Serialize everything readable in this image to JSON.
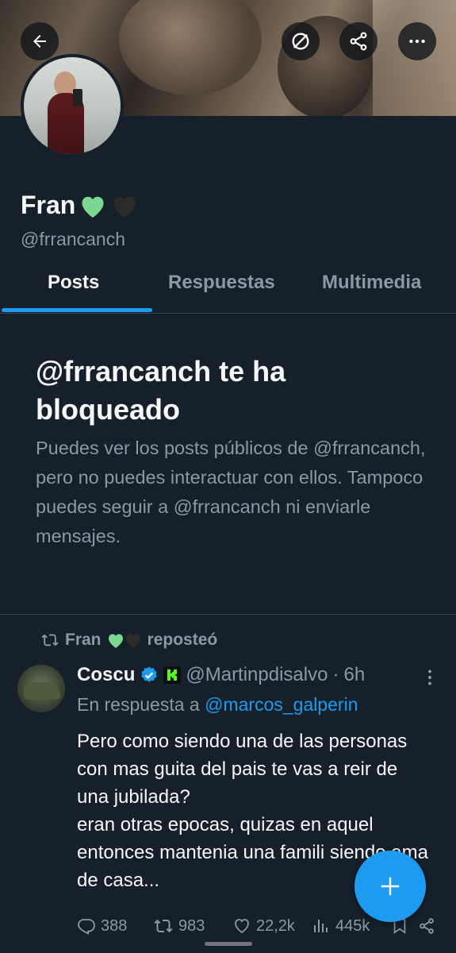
{
  "header": {
    "back_icon": "arrow-left-icon",
    "actions": [
      "premium-icon",
      "share-icon",
      "more-icon"
    ]
  },
  "profile": {
    "name": "Fran",
    "emoji": [
      "green-heart",
      "black-heart"
    ],
    "handle": "@frrancanch"
  },
  "tabs": [
    {
      "label": "Posts",
      "active": true
    },
    {
      "label": "Respuestas",
      "active": false
    },
    {
      "label": "Multimedia",
      "active": false
    }
  ],
  "blocked": {
    "title": "@frrancanch te ha bloqueado",
    "body": "Puedes ver los posts públicos de @frrancanch, pero no puedes interactuar con ellos. Tampoco puedes seguir a @frrancanch ni enviarle mensajes."
  },
  "repost": {
    "by": "Fran",
    "label": "reposteó"
  },
  "tweet": {
    "author": "Coscu",
    "username": "@Martinpdisalvo",
    "separator": "·",
    "time": "6h",
    "reply_prefix": "En respuesta a",
    "reply_to": "@marcos_galperin",
    "text": "Pero como siendo una de las personas con mas guita del pais te vas a reir de una jubilada?\neran otras epocas, quizas en aquel entonces mantenia una famili siendo ama de casa...",
    "replies": "388",
    "reposts": "983",
    "likes": "22,2k",
    "views": "445k"
  },
  "colors": {
    "background": "#15202b",
    "accent": "#1d9bf0",
    "muted": "#8b98a5",
    "divider": "#38444d"
  }
}
